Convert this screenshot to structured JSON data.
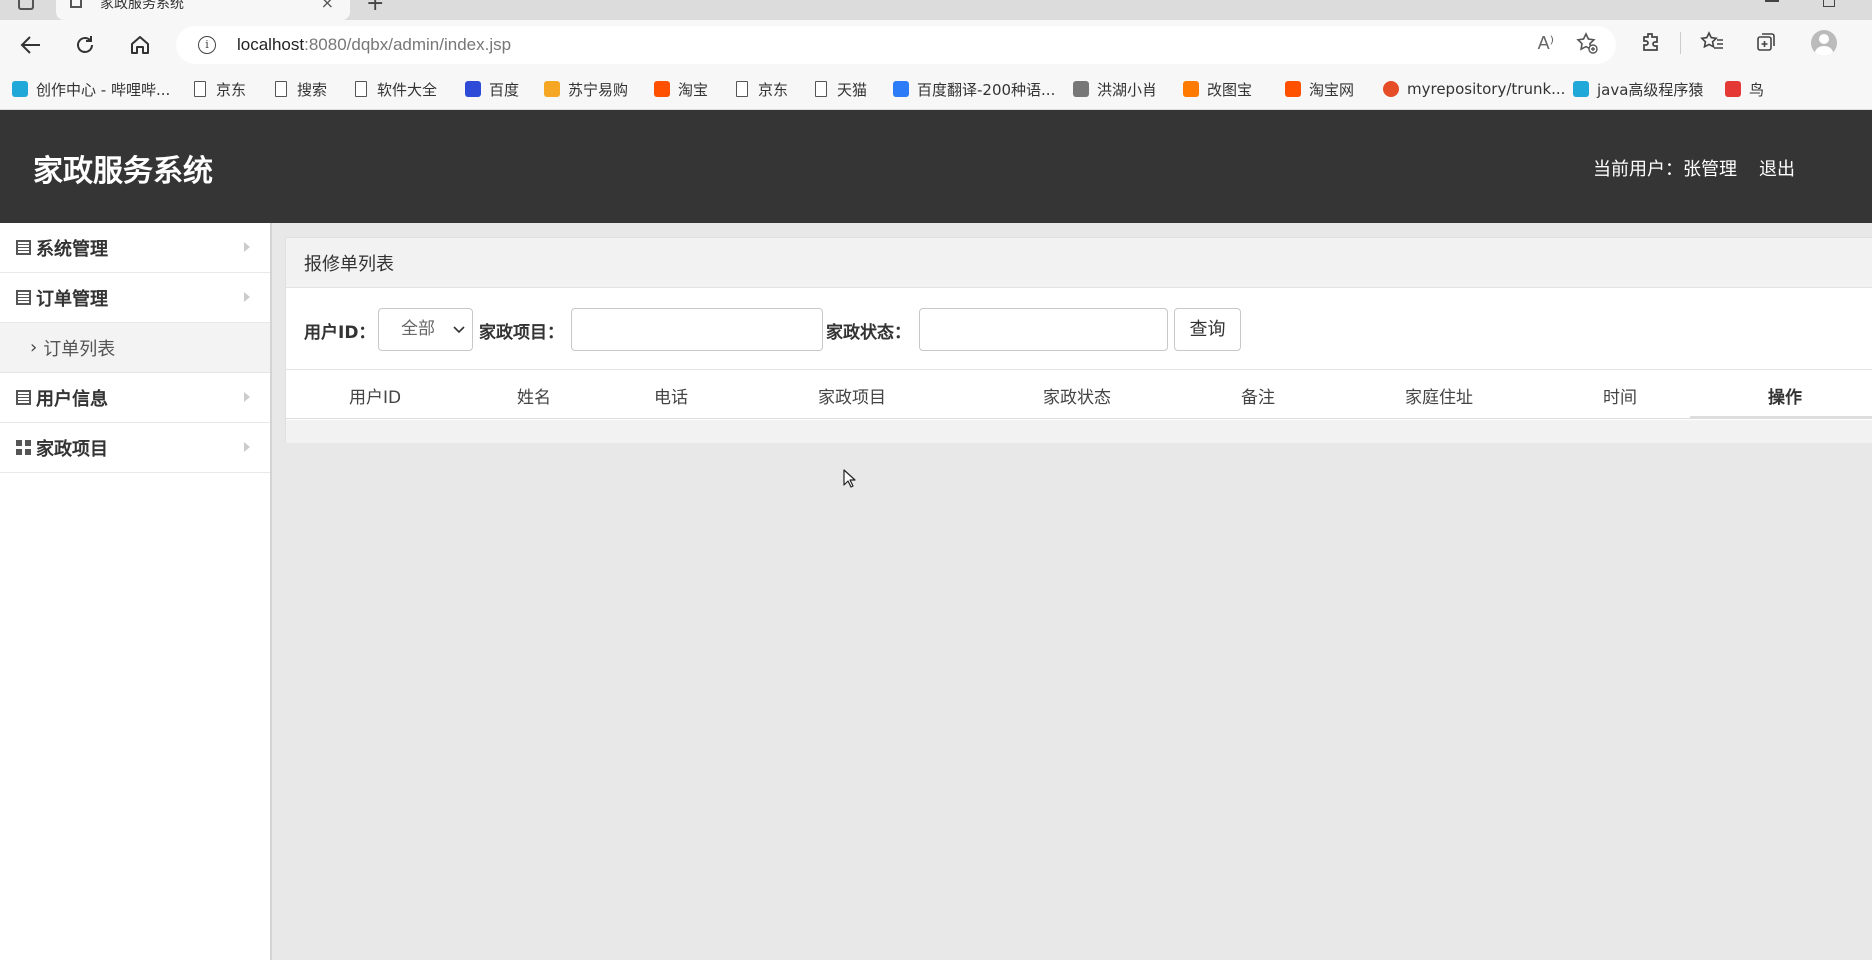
{
  "browser": {
    "tab_title": "家政服务系统",
    "tab_close": "×",
    "new_tab": "+",
    "url_host": "localhost",
    "url_rest": ":8080/dqbx/admin/index.jsp",
    "info_glyph": "i",
    "read_aloud_glyph": "A⁾",
    "bookmarks": [
      {
        "label": "创作中心 - 哔哩哔...",
        "icon": "bilibili-icon",
        "color": "#20a8d8"
      },
      {
        "label": "京东",
        "icon": "page-icon"
      },
      {
        "label": "搜索",
        "icon": "page-icon"
      },
      {
        "label": "软件大全",
        "icon": "page-icon"
      },
      {
        "label": "百度",
        "icon": "baidu-icon",
        "color": "#2d4bd6"
      },
      {
        "label": "苏宁易购",
        "icon": "suning-icon",
        "color": "#f5a623"
      },
      {
        "label": "淘宝",
        "icon": "taobao-icon",
        "color": "#ff5000"
      },
      {
        "label": "京东",
        "icon": "page-icon"
      },
      {
        "label": "天猫",
        "icon": "page-icon"
      },
      {
        "label": "百度翻译-200种语...",
        "icon": "baidu-translate-icon",
        "color": "#2b7cf6"
      },
      {
        "label": "洪湖小肖",
        "icon": "bird-icon",
        "color": "#777777"
      },
      {
        "label": "改图宝",
        "icon": "gaitubao-icon",
        "color": "#ff7a00"
      },
      {
        "label": "淘宝网",
        "icon": "taobao-icon",
        "color": "#ff5000"
      },
      {
        "label": "myrepository/trunk...",
        "icon": "repo-icon",
        "color": "#e44d26"
      },
      {
        "label": "java高级程序猿",
        "icon": "bilibili-icon",
        "color": "#20a8d8"
      },
      {
        "label": "鸟",
        "icon": "bird-icon",
        "color": "#e53935"
      }
    ]
  },
  "header": {
    "title": "家政服务系统",
    "current_user": "当前用户：张管理",
    "logout": "退出",
    "bg_color": "#353535"
  },
  "sidebar": {
    "items": [
      {
        "label": "系统管理",
        "icon": "list-icon"
      },
      {
        "label": "订单管理",
        "icon": "list-icon"
      },
      {
        "label": "订单列表",
        "icon": "chevron-right-icon",
        "sub": true
      },
      {
        "label": "用户信息",
        "icon": "list-icon"
      },
      {
        "label": "家政项目",
        "icon": "grid-icon"
      }
    ]
  },
  "panel": {
    "title": "报修单列表",
    "filters": {
      "user_id_label": "用户ID：",
      "user_id_value": "全部",
      "project_label": "家政项目：",
      "project_value": "",
      "status_label": "家政状态：",
      "status_value": "",
      "query_button": "查询"
    },
    "columns": [
      "用户ID",
      "姓名",
      "电话",
      "家政项目",
      "家政状态",
      "备注",
      "家庭住址",
      "时间",
      "操作"
    ],
    "rows": []
  }
}
